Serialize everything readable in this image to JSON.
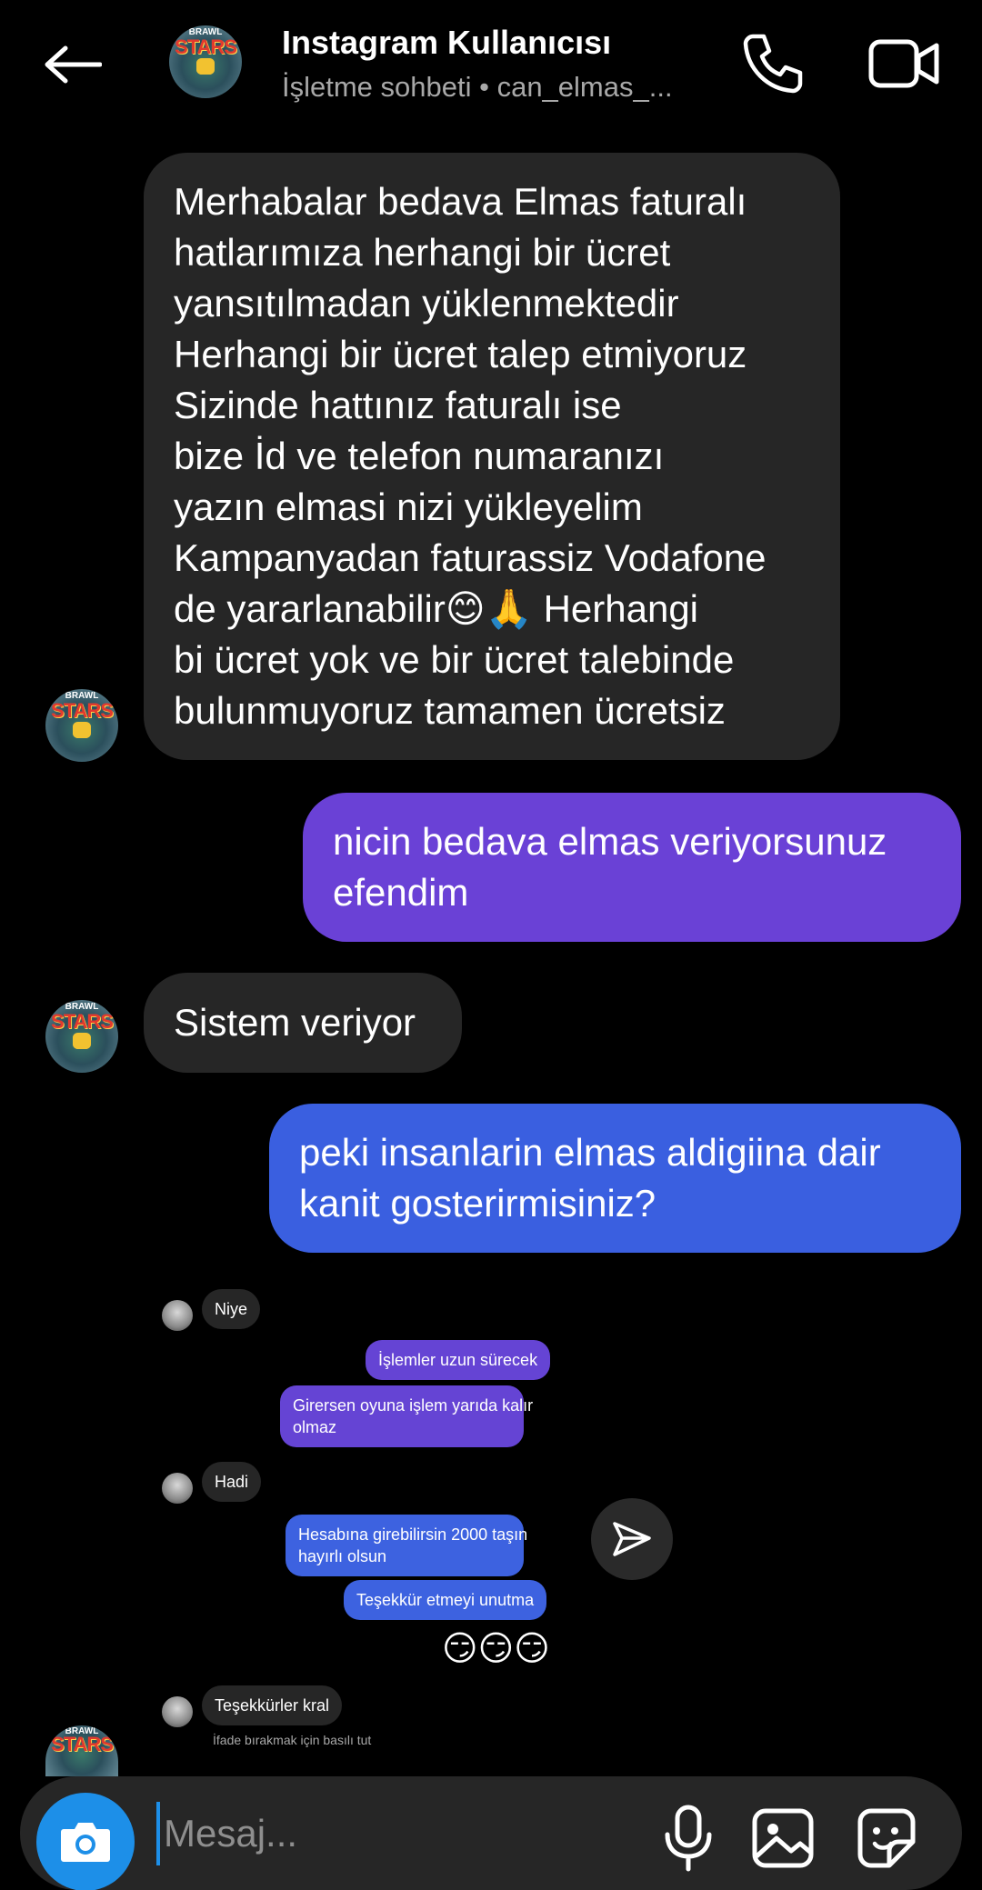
{
  "header": {
    "title": "Instagram Kullanıcısı",
    "subtitle": "İşletme sohbeti • can_elmas_...",
    "avatar_text_top": "BRAWL",
    "avatar_text_main": "STARS"
  },
  "messages": [
    {
      "direction": "incoming",
      "lines": [
        "Merhabalar bedava Elmas faturalı",
        "hatlarımıza herhangi bir ücret",
        "yansıtılmadan yüklenmektedir",
        "Herhangi bir ücret talep etmiyoruz",
        "Sizinde hattınız faturalı ise",
        "bize İd ve telefon numaranızı",
        "yazın elmasi nizi yükleyelim",
        "Kampanyadan faturassiz Vodafone",
        "de yararlanabilir😊🙏 Herhangi",
        "bi ücret yok ve bir ücret talebinde",
        "bulunmuyoruz tamamen ücretsiz"
      ]
    },
    {
      "direction": "outgoing",
      "lines": [
        "nicin bedava elmas veriyorsunuz",
        "efendim"
      ]
    },
    {
      "direction": "incoming",
      "lines": [
        "Sistem veriyor"
      ]
    },
    {
      "direction": "outgoing",
      "lines": [
        "peki insanlarin elmas aldigiina dair",
        "kanit gosterirmisiniz?"
      ]
    }
  ],
  "embedded_screenshot": {
    "in1": "Niye",
    "out1": "İşlemler uzun sürecek",
    "out2_l1": "Girersen oyuna işlem yarıda kalır",
    "out2_l2": "olmaz",
    "in2": "Hadi",
    "out3_l1": "Hesabına girebilirsin 2000 taşın",
    "out3_l2": "hayırlı olsun",
    "out4": "Teşekkür etmeyi unutma",
    "emoji": "😏😏😏",
    "in3": "Teşekkürler kral",
    "hint": "İfade bırakmak için basılı tut"
  },
  "composer": {
    "placeholder": "Mesaj..."
  },
  "colors": {
    "incoming_bubble": "#262626",
    "outgoing_purple": "#6a41d6",
    "outgoing_blue": "#3a5fe0",
    "camera_button": "#1d8fe8"
  },
  "icons": {
    "back": "back-arrow-icon",
    "call": "phone-icon",
    "video": "video-camera-icon",
    "camera": "camera-icon",
    "mic": "microphone-icon",
    "gallery": "gallery-icon",
    "sticker": "sticker-icon",
    "send": "send-icon"
  }
}
